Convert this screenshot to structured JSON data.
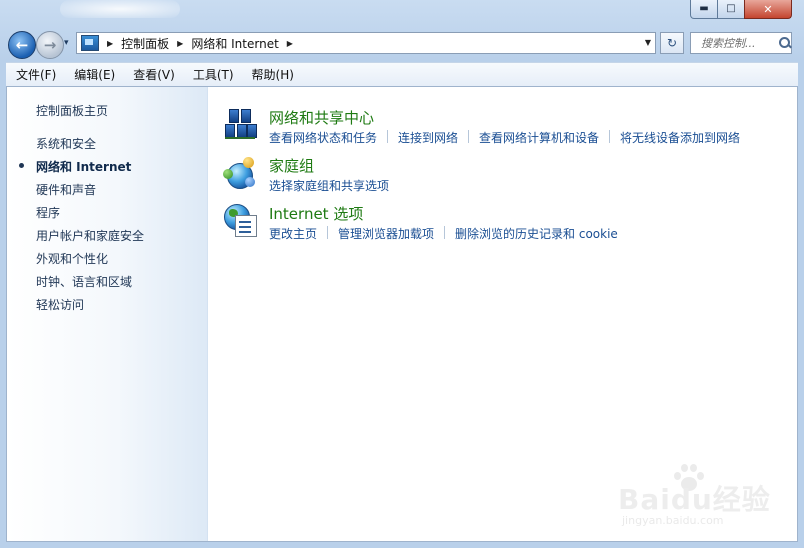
{
  "window": {
    "controls": {
      "minimize": "▬",
      "maximize": "□",
      "close": "✕"
    }
  },
  "nav": {
    "back_symbol": "←",
    "forward_symbol": "→",
    "history_dropdown": "▾",
    "breadcrumb": [
      "控制面板",
      "网络和 Internet"
    ],
    "breadcrumb_sep": "▶",
    "address_dropdown": "▼",
    "refresh_symbol": "↻",
    "search_placeholder": "搜索控制..."
  },
  "menubar": {
    "items": [
      "文件(F)",
      "编辑(E)",
      "查看(V)",
      "工具(T)",
      "帮助(H)"
    ]
  },
  "sidebar": {
    "items": [
      {
        "label": "控制面板主页",
        "active": false
      },
      {
        "label": "系统和安全",
        "active": false
      },
      {
        "label": "网络和 Internet",
        "active": true
      },
      {
        "label": "硬件和声音",
        "active": false
      },
      {
        "label": "程序",
        "active": false
      },
      {
        "label": "用户帐户和家庭安全",
        "active": false
      },
      {
        "label": "外观和个性化",
        "active": false
      },
      {
        "label": "时钟、语言和区域",
        "active": false
      },
      {
        "label": "轻松访问",
        "active": false
      }
    ]
  },
  "categories": [
    {
      "title": "网络和共享中心",
      "icon": "network-center-icon",
      "links": [
        "查看网络状态和任务",
        "连接到网络",
        "查看网络计算机和设备",
        "将无线设备添加到网络"
      ]
    },
    {
      "title": "家庭组",
      "icon": "homegroup-icon",
      "links": [
        "选择家庭组和共享选项"
      ]
    },
    {
      "title": "Internet 选项",
      "icon": "internet-options-icon",
      "links": [
        "更改主页",
        "管理浏览器加载项",
        "删除浏览的历史记录和 cookie"
      ]
    }
  ],
  "watermark": {
    "brand": "Baidu经验",
    "url": "jingyan.baidu.com"
  },
  "colors": {
    "link": "#1a4e93",
    "category_title": "#1e7a12",
    "sidebar_text": "#1f3655"
  }
}
